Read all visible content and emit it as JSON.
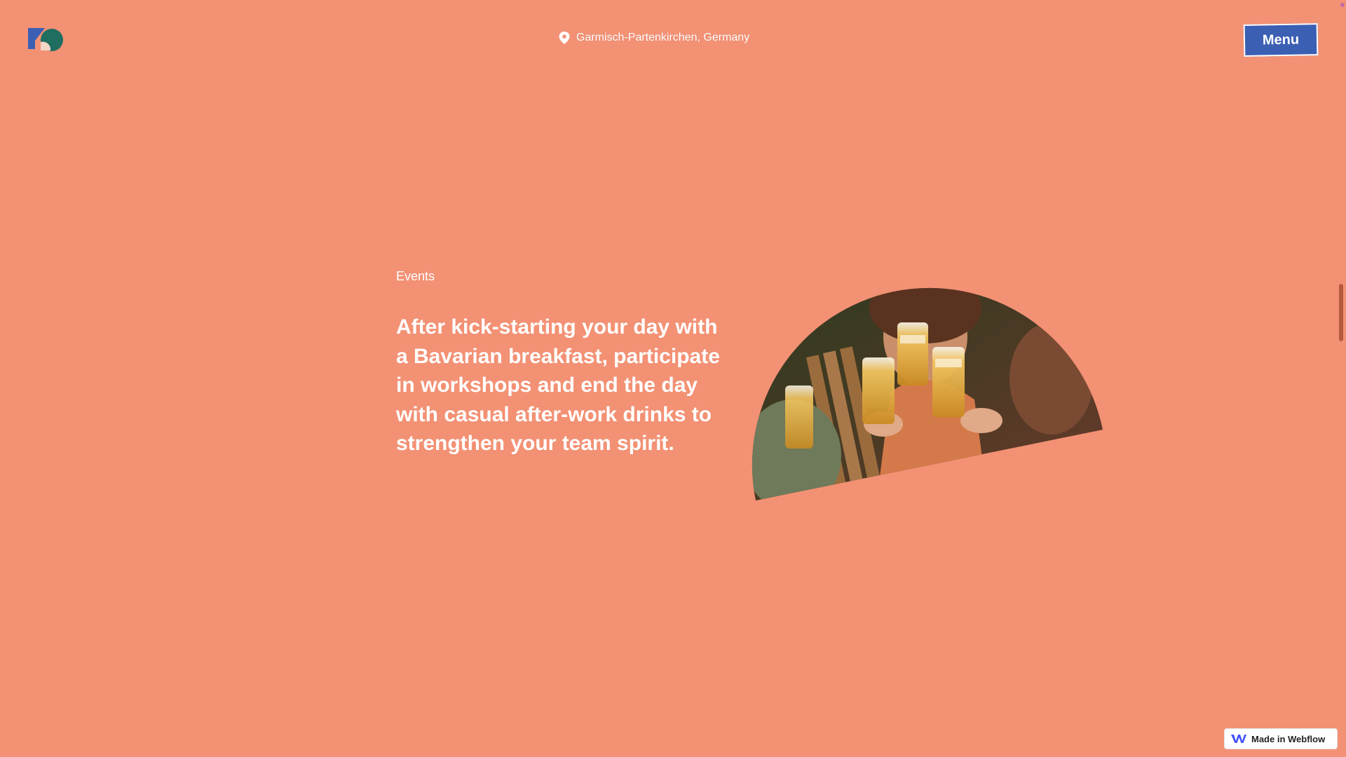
{
  "header": {
    "logo_icon": "brand-logo-icon",
    "location_icon": "map-pin-icon",
    "location_text": "Garmisch-Partenkirchen, Germany",
    "menu_label": "Menu"
  },
  "main": {
    "section_label": "Events",
    "headline": "After kick-starting your day with a Bavarian breakfast, participate in workshops and end the day with casual after-work drinks to strengthen your team spirit.",
    "image_description_icon": "people-toasting-beer-photo"
  },
  "badge": {
    "icon": "webflow-logo-icon",
    "label": "Made in Webflow"
  },
  "colors": {
    "background": "#f39174",
    "menu_button": "#3b5fb3",
    "text": "#ffffff"
  }
}
